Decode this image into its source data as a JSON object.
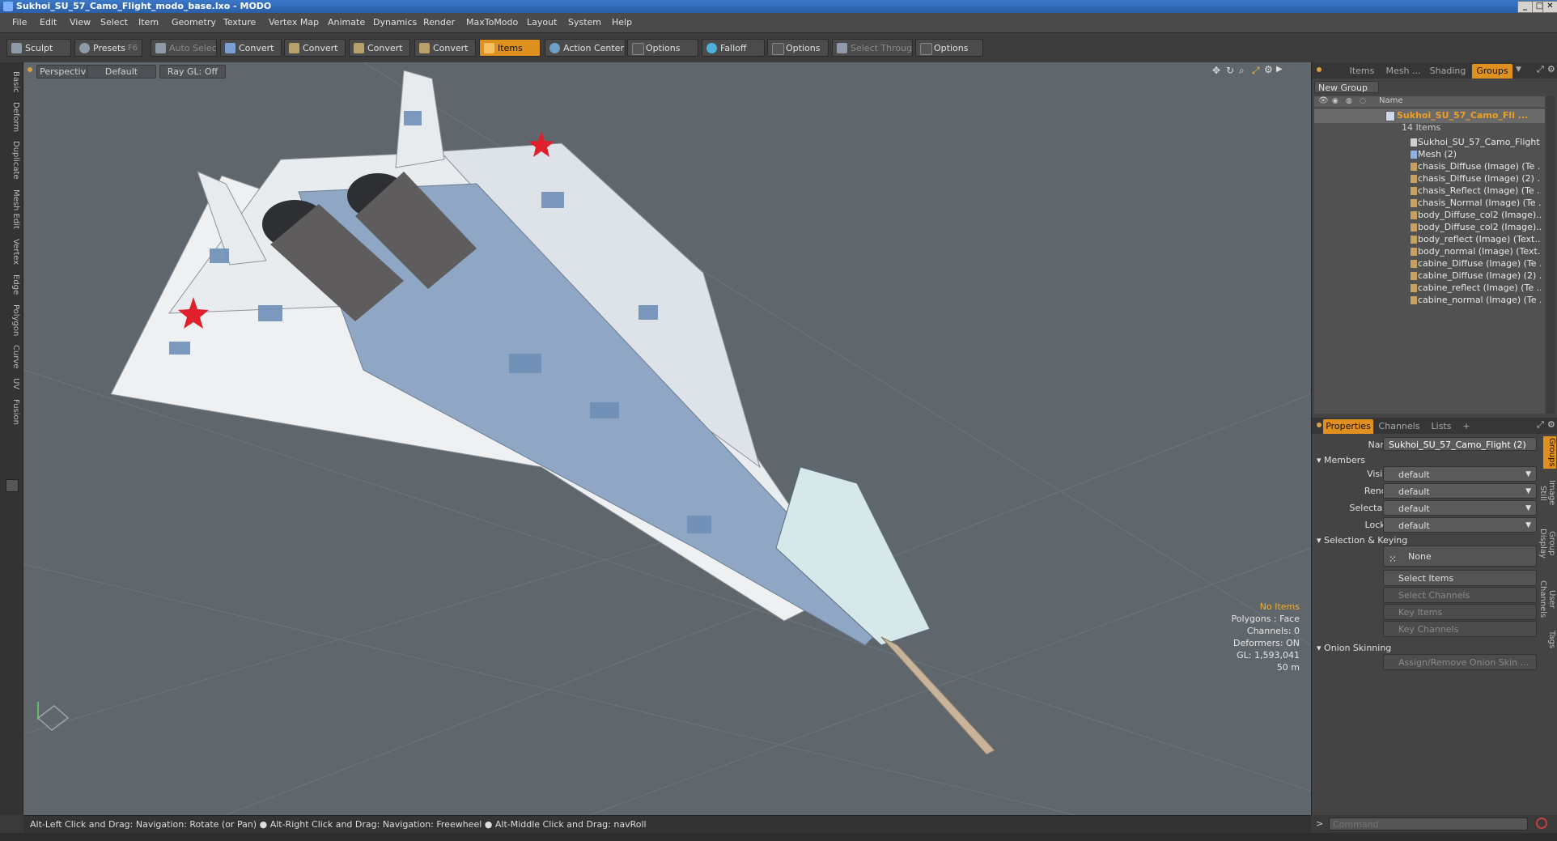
{
  "window": {
    "title": "Sukhoi_SU_57_Camo_Flight_modo_base.lxo - MODO"
  },
  "menu": [
    "File",
    "Edit",
    "View",
    "Select",
    "Item",
    "Geometry",
    "Texture",
    "Vertex Map",
    "Animate",
    "Dynamics",
    "Render",
    "MaxToModo",
    "Layout",
    "System",
    "Help"
  ],
  "toolbar": {
    "sculpt": "Sculpt",
    "presets": "Presets",
    "presets_key": "F6",
    "auto_select": "Auto Select",
    "convert": "Convert",
    "items": "Items",
    "action_center": "Action Center",
    "options": "Options",
    "falloff": "Falloff",
    "select_through": "Select Through"
  },
  "left_tabs": [
    "Basic",
    "Deform",
    "Duplicate",
    "Mesh Edit",
    "Vertex",
    "Edge",
    "Polygon",
    "Curve",
    "UV",
    "Fusion"
  ],
  "viewport": {
    "view": "Perspective",
    "style": "Default",
    "raygl": "Ray GL: Off",
    "stats": {
      "no_items": "No Items",
      "polygons": "Polygons : Face",
      "channels": "Channels: 0",
      "deformers": "Deformers: ON",
      "gl": "GL: 1,593,041",
      "dist": "50 m"
    }
  },
  "statusbar": "Alt-Left Click and Drag: Navigation: Rotate (or Pan) ● Alt-Right Click and Drag: Navigation: Freewheel ● Alt-Middle Click and Drag: navRoll",
  "right_top": {
    "tabs": [
      "Items",
      "Mesh ...",
      "Shading",
      "Groups"
    ],
    "new_group": "New Group",
    "col_name": "Name",
    "group_name": "Sukhoi_SU_57_Camo_Fli ...",
    "group_count": "14 Items",
    "items": [
      "Sukhoi_SU_57_Camo_Flight",
      "Mesh (2)",
      "chasis_Diffuse (Image) (Te ...",
      "chasis_Diffuse (Image) (2) ...",
      "chasis_Reflect (Image) (Te ...",
      "chasis_Normal (Image) (Te ...",
      "body_Diffuse_col2 (Image)...",
      "body_Diffuse_col2 (Image)...",
      "body_reflect (Image) (Text...",
      "body_normal (Image) (Text...",
      "cabine_Diffuse (Image) (Te ...",
      "cabine_Diffuse (Image) (2) ...",
      "cabine_reflect (Image) (Te ...",
      "cabine_normal (Image) (Te ..."
    ]
  },
  "right_bottom": {
    "tabs": [
      "Properties",
      "Channels",
      "Lists",
      "+"
    ],
    "name_label": "Name",
    "name_value": "Sukhoi_SU_57_Camo_Flight (2)",
    "members": "Members",
    "visible_label": "Visible",
    "render_label": "Render",
    "selectable_label": "Selectable",
    "locked_label": "Locked",
    "default": "default",
    "sel_keying": "Selection & Keying",
    "none": "None",
    "select_items": "Select Items",
    "select_channels": "Select Channels",
    "key_items": "Key Items",
    "key_channels": "Key Channels",
    "onion": "Onion Skinning",
    "assign_onion": "Assign/Remove Onion Skin ...",
    "side_tabs": [
      "Groups",
      "Image Still",
      "Group Display",
      "User Channels",
      "Tags"
    ]
  },
  "command": {
    "placeholder": "Command"
  }
}
